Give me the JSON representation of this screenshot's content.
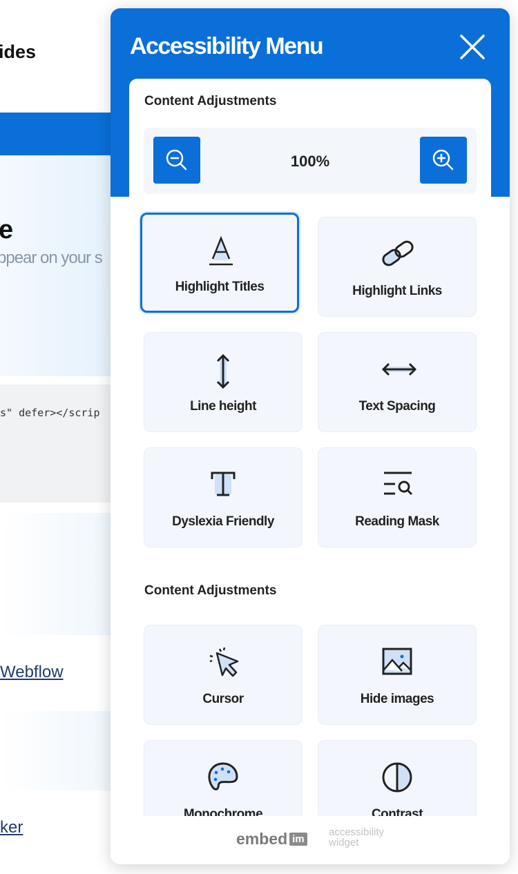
{
  "background": {
    "heading_fragment": "ides",
    "hero_title_fragment": "e",
    "hero_subtitle_fragment": "ppear on your s",
    "code_fragment": "s\" defer></scrip",
    "link1": "Webflow",
    "link2": "ker"
  },
  "panel": {
    "title": "Accessibility Menu",
    "close_icon": "close-x-icon",
    "accent": "#0a6fd8",
    "section1_title": "Content Adjustments",
    "zoom_value": "100%",
    "section1_items": [
      {
        "label": "Highlight Titles",
        "icon": "underlined-a-icon",
        "selected": true
      },
      {
        "label": "Highlight Links",
        "icon": "link-icon"
      },
      {
        "label": "Line height",
        "icon": "vertical-arrows-icon"
      },
      {
        "label": "Text Spacing",
        "icon": "horizontal-arrows-icon"
      },
      {
        "label": "Dyslexia Friendly",
        "icon": "text-t-icon"
      },
      {
        "label": "Reading Mask",
        "icon": "text-search-icon"
      }
    ],
    "section2_title": "Content Adjustments",
    "section2_items": [
      {
        "label": "Cursor",
        "icon": "cursor-click-icon"
      },
      {
        "label": "Hide images",
        "icon": "image-icon"
      },
      {
        "label": "Monochrome",
        "icon": "palette-icon"
      },
      {
        "label": "Contrast",
        "icon": "contrast-icon"
      }
    ],
    "footer": {
      "brand": "embed",
      "brand_badge": "im",
      "tagline_1": "accessibility",
      "tagline_2": "widget"
    }
  }
}
